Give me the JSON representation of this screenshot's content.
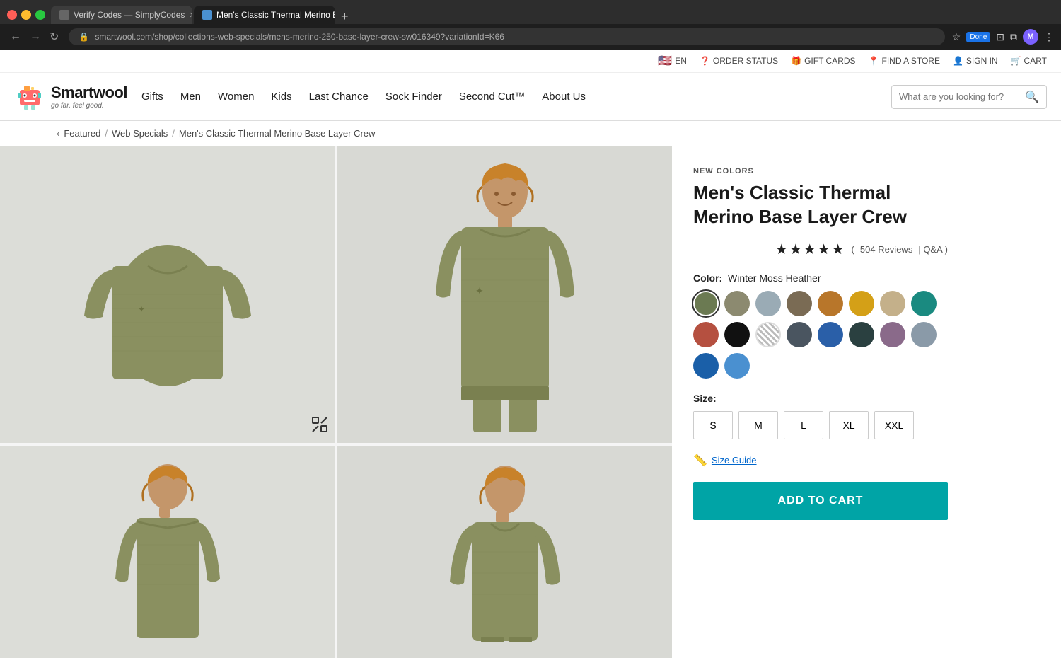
{
  "browser": {
    "tabs": [
      {
        "id": "tab1",
        "title": "Verify Codes — SimplyCodes",
        "active": false,
        "icon": "email"
      },
      {
        "id": "tab2",
        "title": "Men's Classic Thermal Merino B…",
        "active": true,
        "icon": "page"
      }
    ],
    "url": "smartwool.com/shop/collections-web-specials/mens-merino-250-base-layer-crew-sw016349?variationId=K66",
    "profile_initial": "M",
    "done_label": "Done"
  },
  "utility_bar": {
    "language": "EN",
    "order_status": "ORDER STATUS",
    "gift_cards": "GIFT CARDS",
    "find_store": "FIND A STORE",
    "sign_in": "SIGN IN",
    "cart": "CART"
  },
  "logo": {
    "brand": "Smartwool",
    "tagline": "go far. feel good."
  },
  "nav": {
    "items": [
      "Gifts",
      "Men",
      "Women",
      "Kids",
      "Last Chance",
      "Sock Finder",
      "Second Cut™",
      "About Us"
    ]
  },
  "search": {
    "placeholder": "What are you looking for?"
  },
  "breadcrumb": {
    "items": [
      "Featured",
      "Web Specials",
      "Men's Classic Thermal Merino Base Layer Crew"
    ]
  },
  "product": {
    "badge": "NEW COLORS",
    "title": "Men's Classic Thermal Merino Base Layer Crew",
    "rating_stars": "★★★★★",
    "rating_partial": "(",
    "rating_count": "504 Reviews",
    "rating_qa": "| Q&A )",
    "color_label": "Color:",
    "color_selected": "Winter Moss Heather",
    "colors": [
      {
        "id": "c1",
        "hex": "#6b7a52",
        "selected": true,
        "label": "Winter Moss Heather"
      },
      {
        "id": "c2",
        "hex": "#8c8a70",
        "selected": false,
        "label": "Sagebrush Heather"
      },
      {
        "id": "c3",
        "hex": "#9aabb5",
        "selected": false,
        "label": "Light Gray Blue"
      },
      {
        "id": "c4",
        "hex": "#7a6b54",
        "selected": false,
        "label": "Brown"
      },
      {
        "id": "c5",
        "hex": "#b8762a",
        "selected": false,
        "label": "Copper"
      },
      {
        "id": "c6",
        "hex": "#d4a017",
        "selected": false,
        "label": "Amber"
      },
      {
        "id": "c7",
        "hex": "#c4b08a",
        "selected": false,
        "label": "Oatmeal"
      },
      {
        "id": "c8",
        "hex": "#1a8a80",
        "selected": false,
        "label": "Teal"
      },
      {
        "id": "c9",
        "hex": "#b55040",
        "selected": false,
        "label": "Terracotta"
      },
      {
        "id": "c10",
        "hex": "#111111",
        "selected": false,
        "label": "Black"
      },
      {
        "id": "c11",
        "hex": "patterned",
        "selected": false,
        "label": "Patterned"
      },
      {
        "id": "c12",
        "hex": "#4a5560",
        "selected": false,
        "label": "Dark Gray"
      },
      {
        "id": "c13",
        "hex": "#2a5fa8",
        "selected": false,
        "label": "Blue"
      },
      {
        "id": "c14",
        "hex": "#2a4040",
        "selected": false,
        "label": "Dark Teal"
      },
      {
        "id": "c15",
        "hex": "#8a6a8a",
        "selected": false,
        "label": "Purple"
      },
      {
        "id": "c16",
        "hex": "#8a9aa8",
        "selected": false,
        "label": "Slate Blue"
      },
      {
        "id": "c17",
        "hex": "#1a5fa8",
        "selected": false,
        "label": "Cobalt Blue"
      },
      {
        "id": "c18",
        "hex": "#4a90d0",
        "selected": false,
        "label": "Light Blue"
      }
    ],
    "size_label": "Size:",
    "sizes": [
      "S",
      "M",
      "L",
      "XL",
      "XXL"
    ],
    "size_guide": "Size Guide",
    "add_to_cart": "ADD TO CART"
  }
}
